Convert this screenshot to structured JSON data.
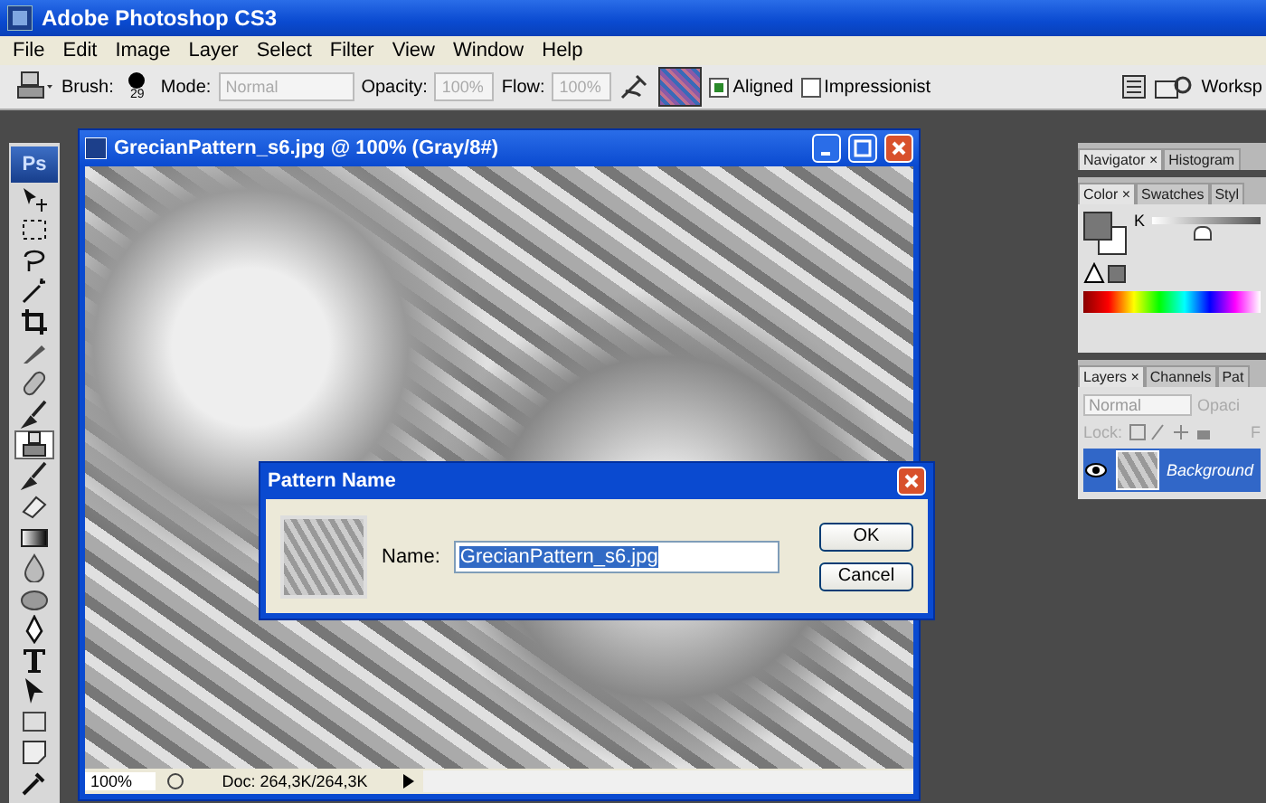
{
  "app_window": {
    "title": "Adobe Photoshop CS3"
  },
  "menu": [
    "File",
    "Edit",
    "Image",
    "Layer",
    "Select",
    "Filter",
    "View",
    "Window",
    "Help"
  ],
  "options_bar": {
    "brush_label": "Brush:",
    "brush_size": "29",
    "mode_label": "Mode:",
    "mode_value": "Normal",
    "opacity_label": "Opacity:",
    "opacity_value": "100%",
    "flow_label": "Flow:",
    "flow_value": "100%",
    "checkboxes": [
      {
        "label": "Aligned",
        "checked": true
      },
      {
        "label": "Impressionist",
        "checked": false
      }
    ],
    "workspace_label": "Worksp"
  },
  "toolbox": {
    "logo": "Ps",
    "tools": [
      {
        "kind": "move",
        "selected": false
      },
      {
        "kind": "marquee",
        "selected": false
      },
      {
        "kind": "lasso",
        "selected": false
      },
      {
        "kind": "wand",
        "selected": false
      },
      {
        "kind": "crop",
        "selected": false
      },
      {
        "kind": "slice",
        "selected": false
      },
      {
        "kind": "heal",
        "selected": false
      },
      {
        "kind": "brush",
        "selected": false
      },
      {
        "kind": "stamp",
        "selected": true
      },
      {
        "kind": "history",
        "selected": false
      },
      {
        "kind": "eraser",
        "selected": false
      },
      {
        "kind": "gradient",
        "selected": false
      },
      {
        "kind": "drop",
        "selected": false
      },
      {
        "kind": "dodge",
        "selected": false
      },
      {
        "kind": "pen",
        "selected": false
      },
      {
        "kind": "type",
        "selected": false
      },
      {
        "kind": "pointer",
        "selected": false
      },
      {
        "kind": "shape",
        "selected": false
      },
      {
        "kind": "note",
        "selected": false
      },
      {
        "kind": "eyedropper",
        "selected": false
      }
    ]
  },
  "document": {
    "title": "GrecianPattern_s6.jpg @ 100% (Gray/8#)",
    "zoom": "100%",
    "doc_size": "Doc: 264,3K/264,3K"
  },
  "panels": {
    "navigator_tabs": [
      {
        "label": "Navigator ×",
        "selected": true
      },
      {
        "label": "Histogram",
        "selected": false
      }
    ],
    "color_tabs": [
      {
        "label": "Color ×",
        "selected": true
      },
      {
        "label": "Swatches",
        "selected": false
      },
      {
        "label": "Styl",
        "selected": false
      }
    ],
    "color_channel": "K",
    "k_slider": {
      "level": 0.45
    },
    "layers_tabs": [
      {
        "label": "Layers ×",
        "selected": true
      },
      {
        "label": "Channels",
        "selected": false
      },
      {
        "label": "Pat",
        "selected": false
      }
    ],
    "blend_mode": "Normal",
    "opacity_label": "Opaci",
    "lock_label": "Lock:",
    "fill_label": "F",
    "layers": [
      {
        "name": "Background",
        "visible": true,
        "selected": true
      }
    ]
  },
  "dialog": {
    "title": "Pattern Name",
    "name_label": "Name:",
    "name_value": "GrecianPattern_s6.jpg",
    "buttons": [
      "OK",
      "Cancel"
    ]
  }
}
